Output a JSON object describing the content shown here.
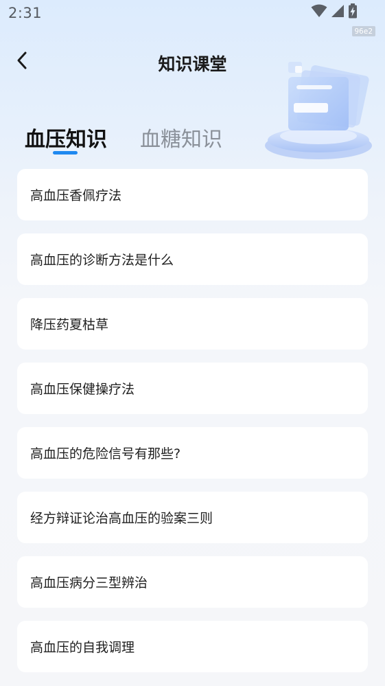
{
  "status_bar": {
    "time": "2:31",
    "tag": "96e2",
    "icons": [
      "wifi-icon",
      "cellular-signal-icon",
      "battery-charging-icon"
    ]
  },
  "header": {
    "title": "知识课堂",
    "back_icon": "chevron-left-icon"
  },
  "tabs": [
    {
      "label": "血压知识",
      "active": true
    },
    {
      "label": "血糖知识",
      "active": false
    }
  ],
  "articles": [
    {
      "title": "高血压香佩疗法"
    },
    {
      "title": "高血压的诊断方法是什么"
    },
    {
      "title": "降压药夏枯草"
    },
    {
      "title": "高血压保健操疗法"
    },
    {
      "title": "高血压的危险信号有那些?"
    },
    {
      "title": "经方辩证论治高血压的验案三则"
    },
    {
      "title": "高血压病分三型辨治"
    },
    {
      "title": "高血压的自我调理"
    }
  ],
  "colors": {
    "accent": "#1e88f0",
    "background_top": "#dcebfd",
    "card": "#ffffff"
  }
}
